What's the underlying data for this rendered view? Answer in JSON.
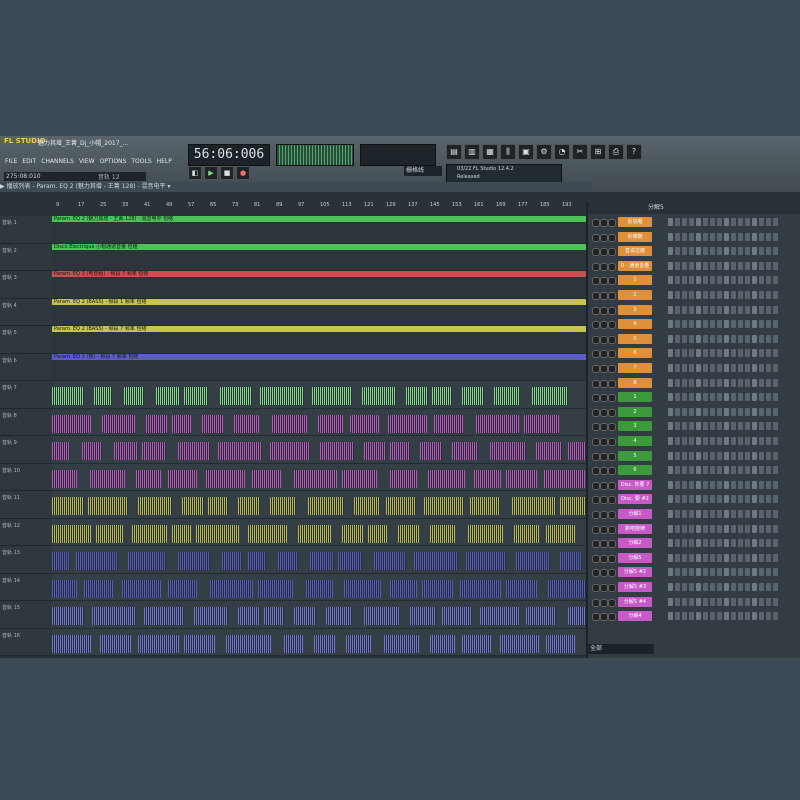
{
  "app": {
    "logo": "FL STUDIO",
    "title": "魅力其增_王菁_Dj_小帽_2017_..."
  },
  "menu": [
    "FILE",
    "EDIT",
    "CHANNELS",
    "VIEW",
    "OPTIONS",
    "TOOLS",
    "HELP"
  ],
  "position_readout": "275:08:010",
  "track_hint": "音轨 12",
  "time_display": "56:06:006",
  "snap_label": "栅格线",
  "hint_panel": {
    "line1": "03/22 FL Studio 12.4.2",
    "line2": "Released"
  },
  "playlist_header": "▶ 播放列表 - Param. EQ 2 (魅力其增 - 王菁 128) - 混音电平 ▾",
  "ruler_ticks": [
    "9",
    "17",
    "25",
    "33",
    "41",
    "49",
    "57",
    "65",
    "73",
    "81",
    "89",
    "97",
    "105",
    "113",
    "121",
    "129",
    "137",
    "145",
    "153",
    "161",
    "169",
    "177",
    "185",
    "193"
  ],
  "tracks": [
    {
      "name": "音轨 1"
    },
    {
      "name": "音轨 2"
    },
    {
      "name": "音轨 3"
    },
    {
      "name": "音轨 4"
    },
    {
      "name": "音轨 5"
    },
    {
      "name": "音轨 6"
    },
    {
      "name": "音轨 7"
    },
    {
      "name": "音轨 8"
    },
    {
      "name": "音轨 9"
    },
    {
      "name": "音轨 10"
    },
    {
      "name": "音轨 11"
    },
    {
      "name": "音轨 12"
    },
    {
      "name": "音轨 13"
    },
    {
      "name": "音轨 14"
    },
    {
      "name": "音轨 15"
    },
    {
      "name": "音轨 16"
    }
  ],
  "automation_clips": [
    {
      "track": 0,
      "label": "Param. EQ 2 (魅力其增 - 王菁 128) - 混音电平 包络",
      "color": "#4ec05a"
    },
    {
      "track": 1,
      "label": "Disco Electrique 小帽通道音量 包络",
      "color": "#4ec05a"
    },
    {
      "track": 2,
      "label": "Param. EQ 2 (电音组) - 频段 7 频率 包络",
      "color": "#c45454"
    },
    {
      "track": 3,
      "label": "Param. EQ 2 (BASS) - 频段 1 频率 包络",
      "color": "#c8c450"
    },
    {
      "track": 4,
      "label": "Param. EQ 2 (BASS) - 频段 7 频率 包络",
      "color": "#c8c450"
    },
    {
      "track": 5,
      "label": "Param. EQ 2 (鼓) - 频段 7 频率 包络",
      "color": "#5c5ccc"
    }
  ],
  "rack": {
    "title": "分解5",
    "footer": "全部",
    "channels": [
      {
        "label": "反说唱",
        "color": "#e0903a"
      },
      {
        "label": "反律鼓",
        "color": "#e0903a"
      },
      {
        "label": "直说过度",
        "color": "#e0903a"
      },
      {
        "label": "0 - 通道音量",
        "color": "#e0903a"
      },
      {
        "label": "1",
        "color": "#e0903a"
      },
      {
        "label": "2",
        "color": "#e0903a"
      },
      {
        "label": "3",
        "color": "#e0903a"
      },
      {
        "label": "4",
        "color": "#e0903a"
      },
      {
        "label": "5",
        "color": "#e0903a"
      },
      {
        "label": "6",
        "color": "#e0903a"
      },
      {
        "label": "7",
        "color": "#e0903a"
      },
      {
        "label": "8",
        "color": "#e0903a"
      },
      {
        "label": "1",
        "color": "#3c9a3c"
      },
      {
        "label": "2",
        "color": "#3c9a3c"
      },
      {
        "label": "3",
        "color": "#3c9a3c"
      },
      {
        "label": "4",
        "color": "#3c9a3c"
      },
      {
        "label": "5",
        "color": "#3c9a3c"
      },
      {
        "label": "6",
        "color": "#3c9a3c"
      },
      {
        "label": "Disc. 你要 7",
        "color": "#c85ac8"
      },
      {
        "label": "Disc. 要 #2",
        "color": "#c85ac8"
      },
      {
        "label": "分解1",
        "color": "#c85ac8"
      },
      {
        "label": "新吧旋律",
        "color": "#c85ac8"
      },
      {
        "label": "分解2",
        "color": "#c85ac8"
      },
      {
        "label": "分解5",
        "color": "#c85ac8"
      },
      {
        "label": "分解5 #2",
        "color": "#c85ac8"
      },
      {
        "label": "分解5 #3",
        "color": "#c85ac8"
      },
      {
        "label": "分解5 #4",
        "color": "#c85ac8"
      },
      {
        "label": "分解4",
        "color": "#c85ac8"
      }
    ]
  },
  "colors": {
    "green": "#4ec05a",
    "yellow": "#c8c450",
    "red": "#c45454",
    "blue": "#5c5ccc",
    "purple": "#c85ac8",
    "lime": "#8ce88c"
  }
}
